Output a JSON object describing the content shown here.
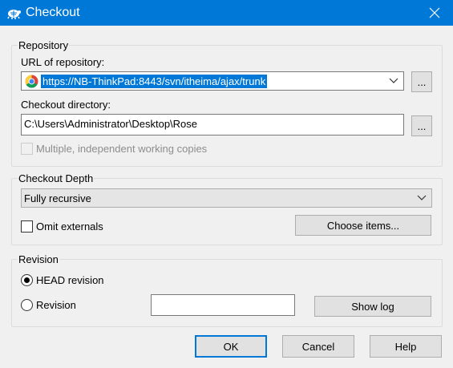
{
  "window": {
    "title": "Checkout",
    "app_icon": "tortoise-icon",
    "close_icon": "close-icon",
    "titlebar_color": "#0078d7"
  },
  "repository": {
    "group_label": "Repository",
    "url_label": "URL of repository:",
    "url_value": "https://NB-ThinkPad:8443/svn/itheima/ajax/trunk",
    "url_icon": "chrome-icon",
    "browse_label": "...",
    "dir_label": "Checkout directory:",
    "dir_value": "C:\\Users\\Administrator\\Desktop\\Rose",
    "dir_browse_label": "...",
    "multiple_label": "Multiple, independent working copies",
    "multiple_checked": false,
    "multiple_enabled": false
  },
  "depth": {
    "group_label": "Checkout Depth",
    "selected": "Fully recursive",
    "omit_label": "Omit externals",
    "omit_checked": false,
    "choose_label": "Choose items..."
  },
  "revision": {
    "group_label": "Revision",
    "head_label": "HEAD revision",
    "head_selected": true,
    "rev_label": "Revision",
    "rev_value": "",
    "show_log_label": "Show log"
  },
  "buttons": {
    "ok": "OK",
    "cancel": "Cancel",
    "help": "Help"
  }
}
